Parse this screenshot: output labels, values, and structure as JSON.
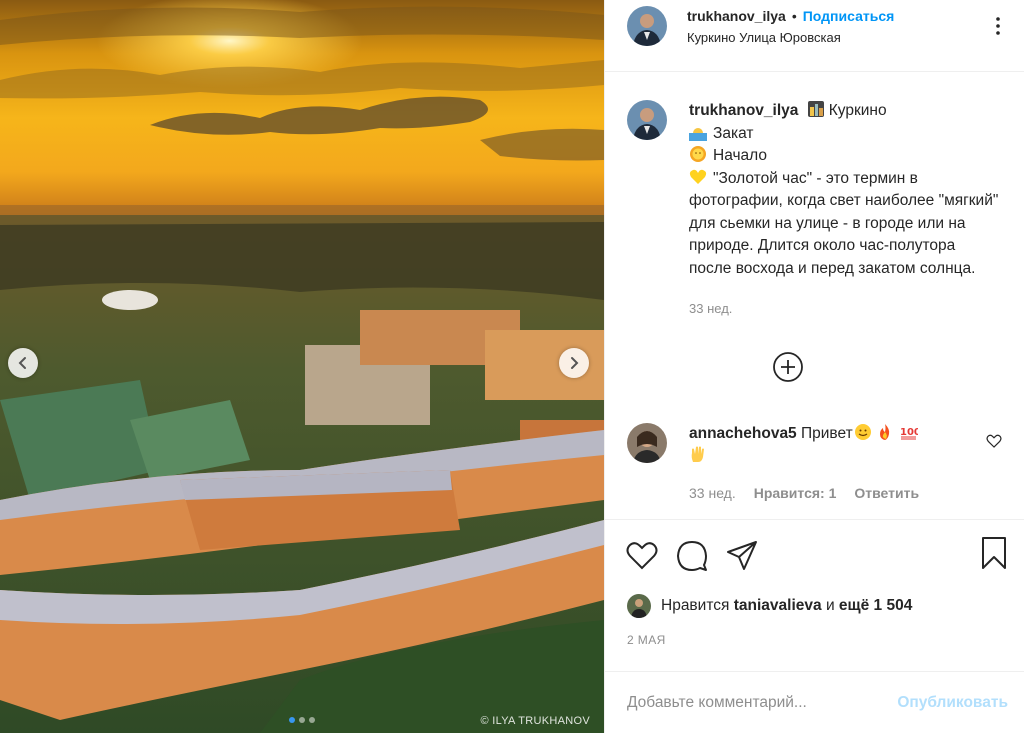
{
  "photo": {
    "watermark": "© ILYA TRUKHANOV",
    "dots_count": 3,
    "active_dot": 1
  },
  "header": {
    "username": "trukhanov_ilya",
    "bullet": "•",
    "follow_label": "Подписаться",
    "location": "Куркино Улица Юровская"
  },
  "caption": {
    "username": "trukhanov_ilya",
    "line1": "Куркино",
    "line2": "Закат",
    "line3": "Начало",
    "line4": "\"Золотой час\" - это термин в фотографии, когда свет наиболее \"мягкий\" для сьемки на улице - в городе или на природе. Длится около час-полутора после восхода и перед закатом солнца.",
    "time": "33 нед."
  },
  "comment": {
    "username": "annachehova5",
    "text": "Привет",
    "time": "33 нед.",
    "likes": "Нравится: 1",
    "reply": "Ответить"
  },
  "likes": {
    "prefix": "Нравится",
    "user": "taniavalieva",
    "and": "и",
    "rest": "ещё 1 504"
  },
  "date": "2 МАЯ",
  "add_comment": {
    "placeholder": "Добавьте комментарий...",
    "publish_label": "Опубликовать"
  },
  "colors": {
    "accent": "#0095f6",
    "publish_disabled": "#b2dffc",
    "muted": "#8e8e8e"
  }
}
